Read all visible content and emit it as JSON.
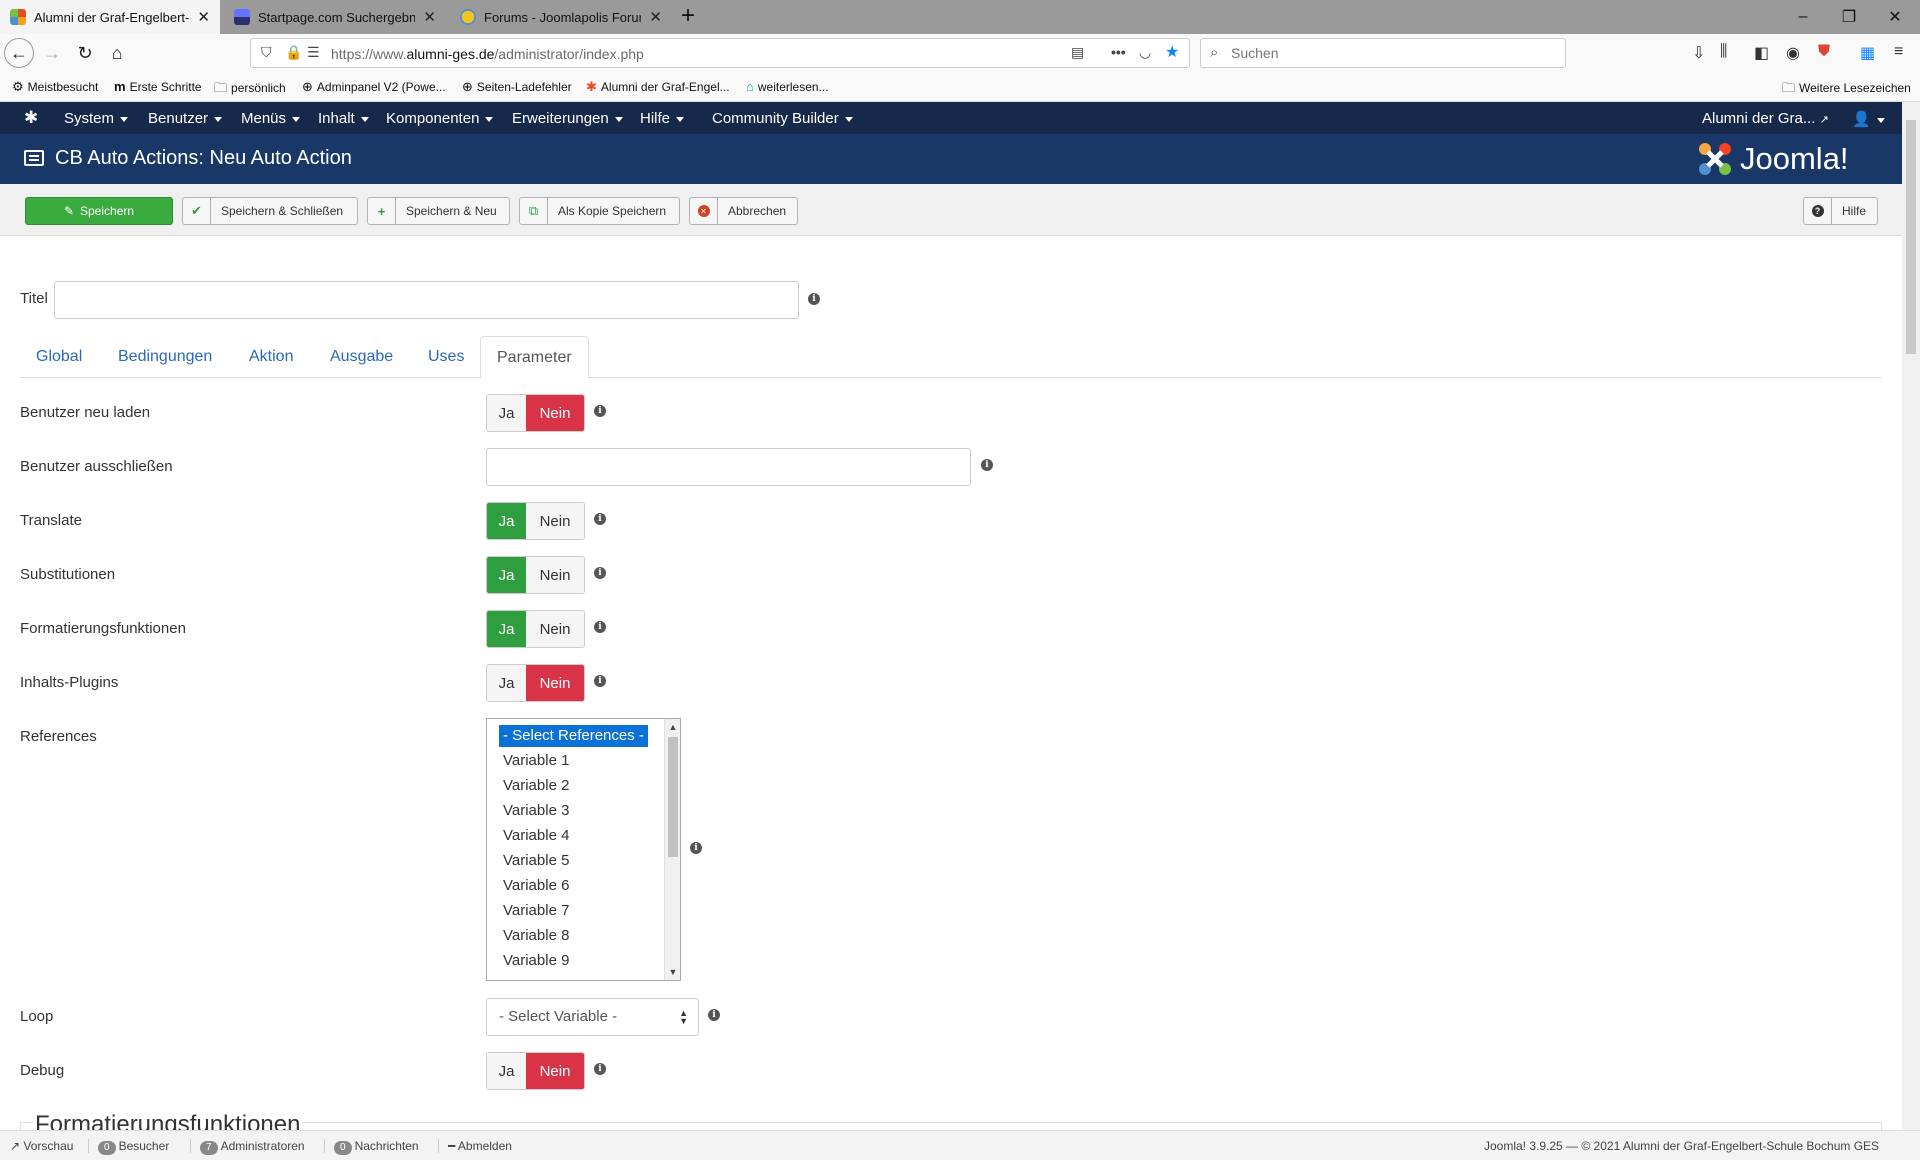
{
  "browser": {
    "tabs": [
      {
        "label": "Alumni der Graf-Engelbert-Sch",
        "active": true
      },
      {
        "label": "Startpage.com Suchergebnisse",
        "active": false
      },
      {
        "label": "Forums - Joomlapolis Forum",
        "active": false
      }
    ],
    "url_prefix": "https://www.",
    "url_domain": "alumni-ges.de",
    "url_path": "/administrator/index.php",
    "search_placeholder": "Suchen",
    "bookmarks": [
      "Meistbesucht",
      "Erste Schritte",
      "persönlich",
      "Adminpanel V2 (Powe...",
      "Seiten-Ladefehler",
      "Alumni der Graf-Engel...",
      "weiterlesen..."
    ],
    "other_bookmarks": "Weitere Lesezeichen"
  },
  "joomla": {
    "menu": [
      "System",
      "Benutzer",
      "Menüs",
      "Inhalt",
      "Komponenten",
      "Erweiterungen",
      "Hilfe",
      "Community Builder"
    ],
    "site_name": "Alumni der Gra...",
    "page_title": "CB Auto Actions: Neu Auto Action",
    "logo_text": "Joomla!"
  },
  "toolbar": {
    "save": "Speichern",
    "save_close": "Speichern & Schließen",
    "save_new": "Speichern & Neu",
    "save_copy": "Als Kopie Speichern",
    "cancel": "Abbrechen",
    "help": "Hilfe"
  },
  "form": {
    "title_label": "Titel",
    "title_value": "",
    "tabs": [
      "Global",
      "Bedingungen",
      "Aktion",
      "Ausgabe",
      "Uses",
      "Parameter"
    ],
    "active_tab": "Parameter",
    "yes": "Ja",
    "no": "Nein",
    "fields": {
      "reload_user": {
        "label": "Benutzer neu laden",
        "value": "Nein"
      },
      "exclude_users": {
        "label": "Benutzer ausschließen",
        "value": ""
      },
      "translate": {
        "label": "Translate",
        "value": "Ja"
      },
      "substitutions": {
        "label": "Substitutionen",
        "value": "Ja"
      },
      "format_functions": {
        "label": "Formatierungsfunktionen",
        "value": "Ja"
      },
      "content_plugins": {
        "label": "Inhalts-Plugins",
        "value": "Nein"
      },
      "references": {
        "label": "References"
      },
      "loop": {
        "label": "Loop",
        "value": "- Select Variable -"
      },
      "debug": {
        "label": "Debug",
        "value": "Nein"
      }
    },
    "references_options": [
      "- Select References -",
      "Variable 1",
      "Variable 2",
      "Variable 3",
      "Variable 4",
      "Variable 5",
      "Variable 6",
      "Variable 7",
      "Variable 8",
      "Variable 9"
    ],
    "fieldset_legend": "Formatierungsfunktionen"
  },
  "status": {
    "preview": "Vorschau",
    "visitors_count": "0",
    "visitors": "Besucher",
    "admins_count": "7",
    "admins": "Administratoren",
    "messages_count": "0",
    "messages": "Nachrichten",
    "logout": "Abmelden",
    "footer": "Joomla! 3.9.25 — © 2021 Alumni der Graf-Engelbert-Schule Bochum GES"
  },
  "colors": {
    "nav_bg": "#17294a",
    "header_bg": "#1a3867",
    "save_green": "#3aab3e",
    "toggle_yes": "#2f9e3e",
    "toggle_no": "#d83347",
    "link_blue": "#2a69b8",
    "select_blue": "#0a72d6"
  }
}
